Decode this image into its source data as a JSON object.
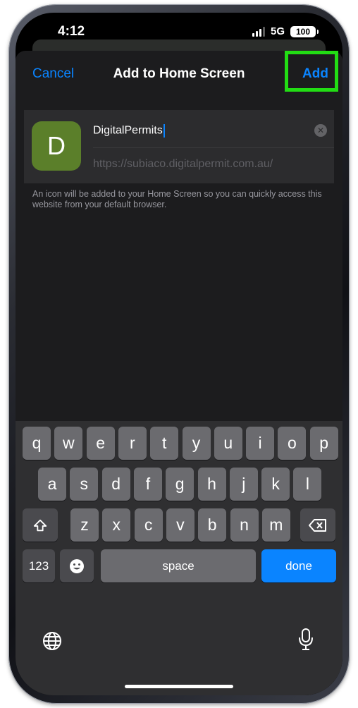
{
  "status": {
    "time": "4:12",
    "network": "5G",
    "battery": "100"
  },
  "nav": {
    "cancel": "Cancel",
    "title": "Add to Home Screen",
    "add": "Add"
  },
  "app": {
    "icon_letter": "D",
    "name": "DigitalPermits",
    "url": "https://subiaco.digitalpermit.com.au/"
  },
  "hint": "An icon will be added to your Home Screen so you can quickly access this website from your default browser.",
  "keyboard": {
    "row1": [
      "q",
      "w",
      "e",
      "r",
      "t",
      "y",
      "u",
      "i",
      "o",
      "p"
    ],
    "row2": [
      "a",
      "s",
      "d",
      "f",
      "g",
      "h",
      "j",
      "k",
      "l"
    ],
    "row3": [
      "z",
      "x",
      "c",
      "v",
      "b",
      "n",
      "m"
    ],
    "numbers": "123",
    "space": "space",
    "done": "done"
  },
  "icons": {
    "shift": "shift-icon",
    "backspace": "backspace-icon",
    "emoji": "emoji-icon",
    "globe": "globe-icon",
    "mic": "microphone-icon",
    "clear": "clear-text-icon"
  },
  "colors": {
    "accent": "#0a84ff",
    "highlight": "#22dd14",
    "app_icon": "#5b7f2a"
  }
}
